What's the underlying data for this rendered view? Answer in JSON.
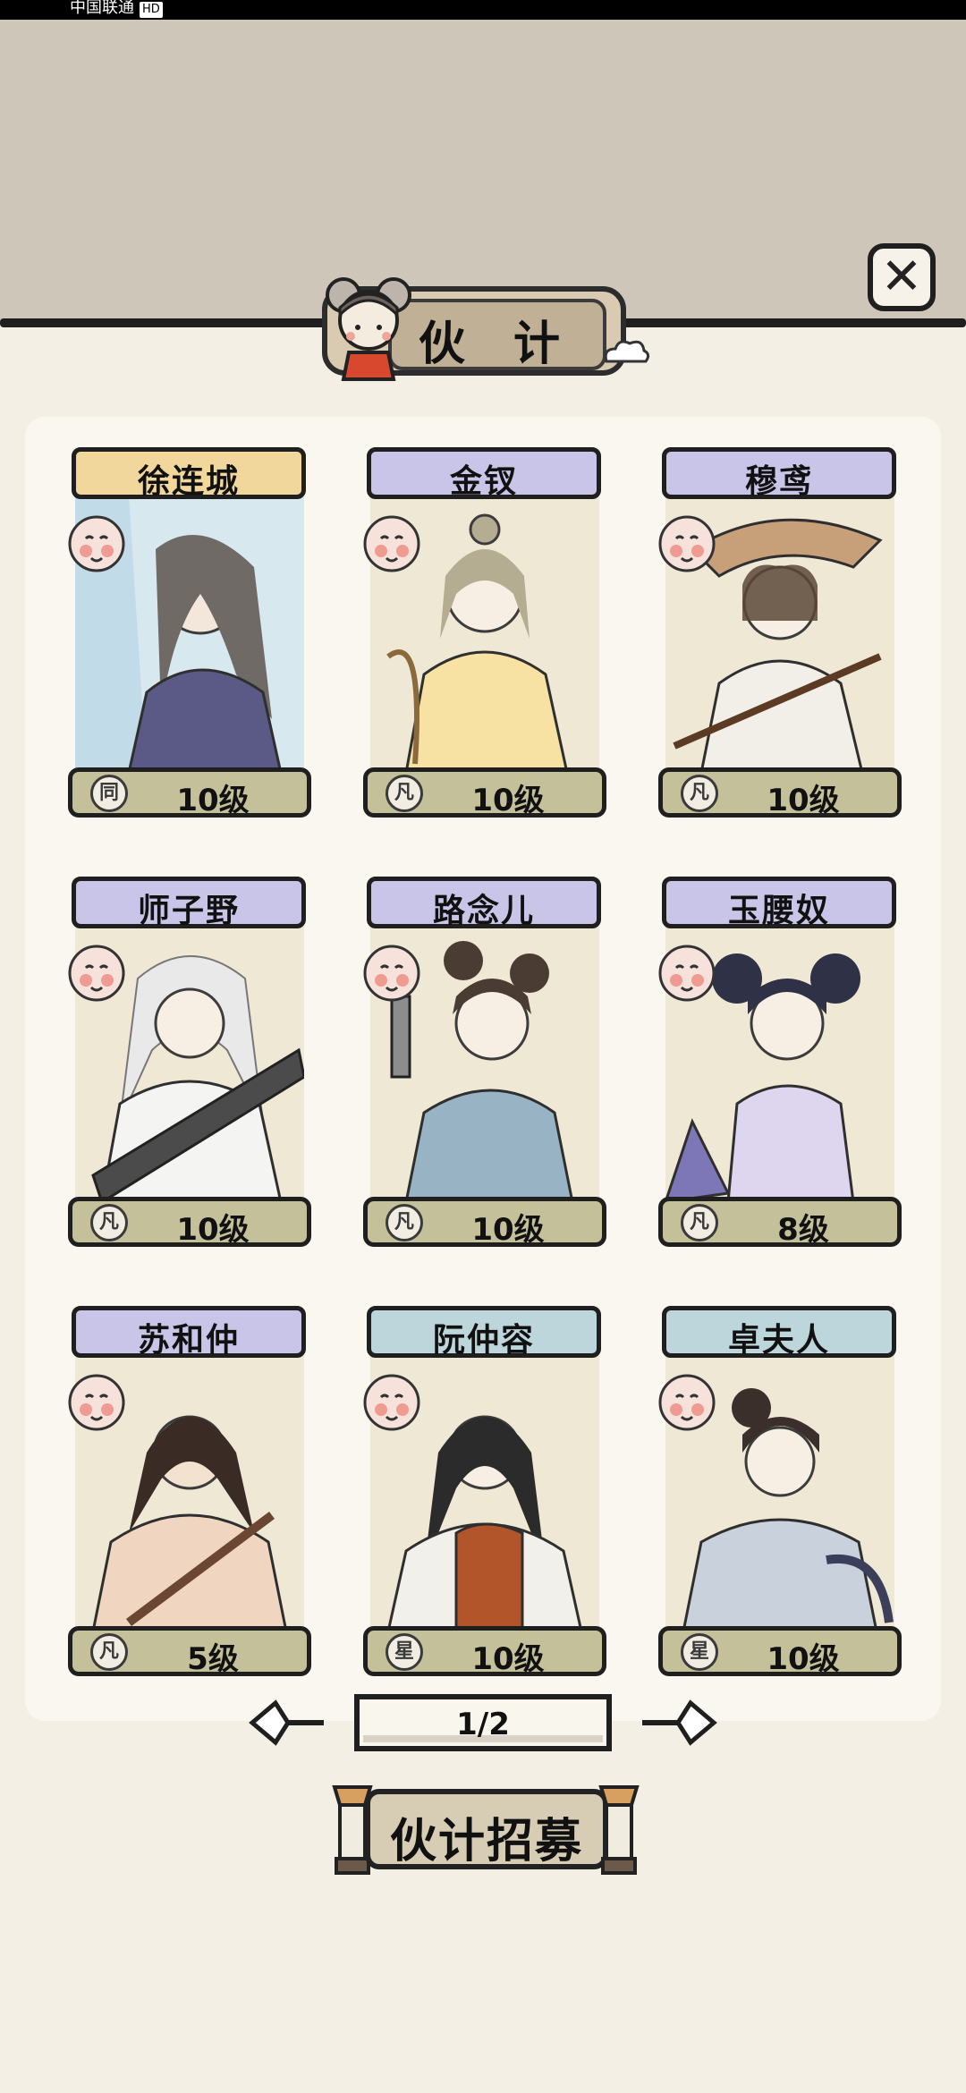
{
  "status": {
    "carrier": "中国联通",
    "hd": "HD"
  },
  "title": "伙 计",
  "close_symbol": "✕",
  "cards": [
    {
      "name": "徐连城",
      "level": "10级",
      "rank": "同",
      "plate_color": "#f1d79c"
    },
    {
      "name": "金钗",
      "level": "10级",
      "rank": "凡",
      "plate_color": "#c9c5e8"
    },
    {
      "name": "穆鸢",
      "level": "10级",
      "rank": "凡",
      "plate_color": "#c9c5e8"
    },
    {
      "name": "师子野",
      "level": "10级",
      "rank": "凡",
      "plate_color": "#c9c5e8"
    },
    {
      "name": "路念儿",
      "level": "10级",
      "rank": "凡",
      "plate_color": "#c9c5e8"
    },
    {
      "name": "玉腰奴",
      "level": "8级",
      "rank": "凡",
      "plate_color": "#c9c5e8"
    },
    {
      "name": "苏和仲",
      "level": "5级",
      "rank": "凡",
      "plate_color": "#c9c5e8"
    },
    {
      "name": "阮仲容",
      "level": "10级",
      "rank": "星",
      "plate_color": "#bcd6dc"
    },
    {
      "name": "卓夫人",
      "level": "10级",
      "rank": "星",
      "plate_color": "#bcd6dc"
    }
  ],
  "pager": {
    "text": "1/2"
  },
  "recruit_label": "伙计招募",
  "colors": {
    "background": "#f4efe4",
    "top_area": "#cfc6ba",
    "panel": "#faf6f0",
    "level_bar": "#c3c09a"
  }
}
